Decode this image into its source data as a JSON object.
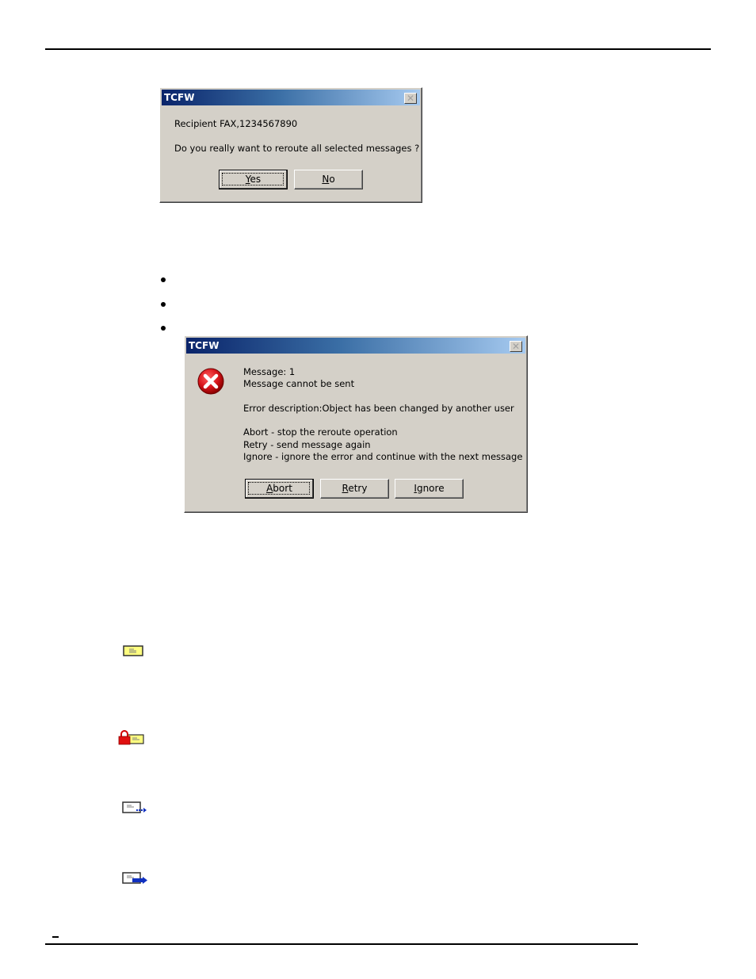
{
  "page": {
    "bullets_count": 3
  },
  "dialog1": {
    "title": "TCFW",
    "close_label": "✕",
    "line1": "Recipient FAX,1234567890",
    "line2": "Do you really want to reroute all selected messages ?",
    "buttons": [
      {
        "pre": "",
        "mnemonic": "Y",
        "post": "es"
      },
      {
        "pre": "",
        "mnemonic": "N",
        "post": "o"
      }
    ]
  },
  "dialog2": {
    "title": "TCFW",
    "close_label": "✕",
    "icon": "error-icon",
    "lines": [
      "Message: 1",
      "Message cannot be sent",
      "",
      "Error description:Object has been changed by another user",
      "",
      "Abort - stop the reroute operation",
      "Retry - send message again",
      "Ignore - ignore the error and continue with the next message"
    ],
    "buttons": [
      {
        "pre": "",
        "mnemonic": "A",
        "post": "bort"
      },
      {
        "pre": "",
        "mnemonic": "R",
        "post": "etry"
      },
      {
        "pre": "",
        "mnemonic": "I",
        "post": "gnore"
      }
    ]
  },
  "icons": [
    {
      "name": "message-icon"
    },
    {
      "name": "locked-message-icon"
    },
    {
      "name": "message-sending-icon"
    },
    {
      "name": "message-sent-icon"
    }
  ],
  "colors": {
    "dialog_bg": "#d4d0c8",
    "title_start": "#0a246a",
    "title_end": "#a6caf0",
    "error_red": "#d8151b",
    "message_yellow": "#ffff80",
    "arrow_blue": "#1030c0"
  }
}
